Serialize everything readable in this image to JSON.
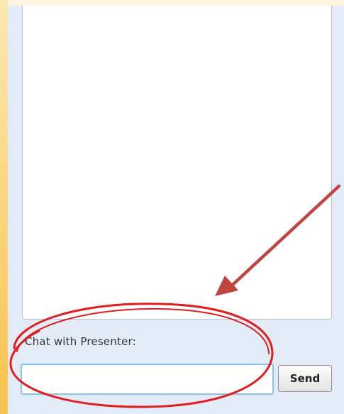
{
  "chat": {
    "label": "Chat with Presenter:",
    "input_value": "",
    "input_placeholder": "",
    "send_label": "Send"
  },
  "colors": {
    "panel_background": "#e2ebf6",
    "accent_strip": "#f7c24d",
    "input_border": "#8fc2ea",
    "annotation_red": "#e01e1e",
    "annotation_arrow": "#c0443f"
  },
  "annotations": {
    "ellipse_icon": "red-ellipse-highlight",
    "arrow_icon": "red-arrow"
  }
}
